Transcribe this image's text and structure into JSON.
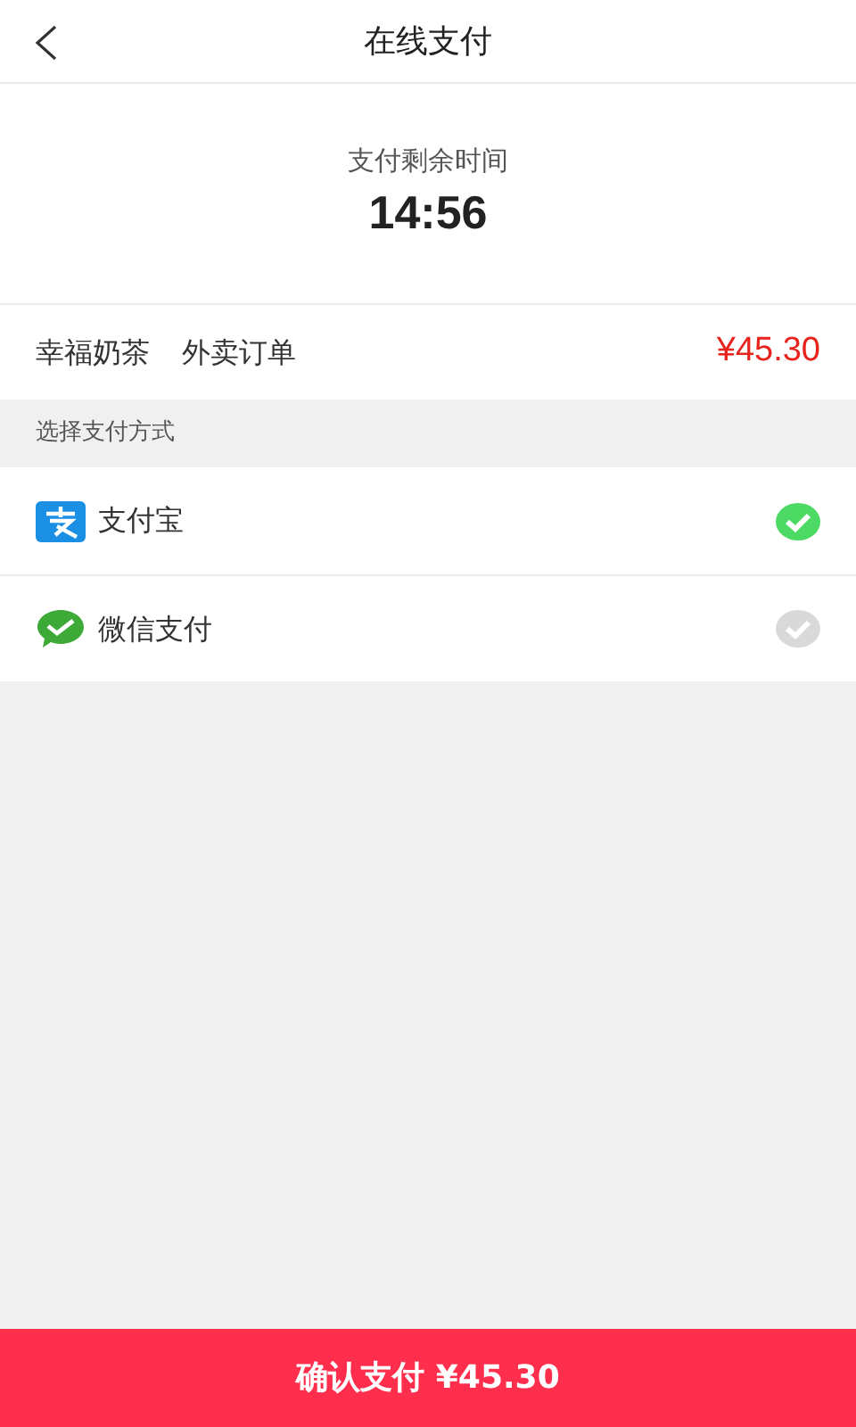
{
  "header": {
    "title": "在线支付"
  },
  "countdown": {
    "label": "支付剩余时间",
    "time": "14:56"
  },
  "order": {
    "shop": "幸福奶茶",
    "type": "外卖订单",
    "amount": "¥45.30"
  },
  "section_title": "选择支付方式",
  "methods": [
    {
      "kind": "alipay",
      "label": "支付宝",
      "selected": true
    },
    {
      "kind": "wechat",
      "label": "微信支付",
      "selected": false
    }
  ],
  "confirm_button": "确认支付 ¥45.30"
}
